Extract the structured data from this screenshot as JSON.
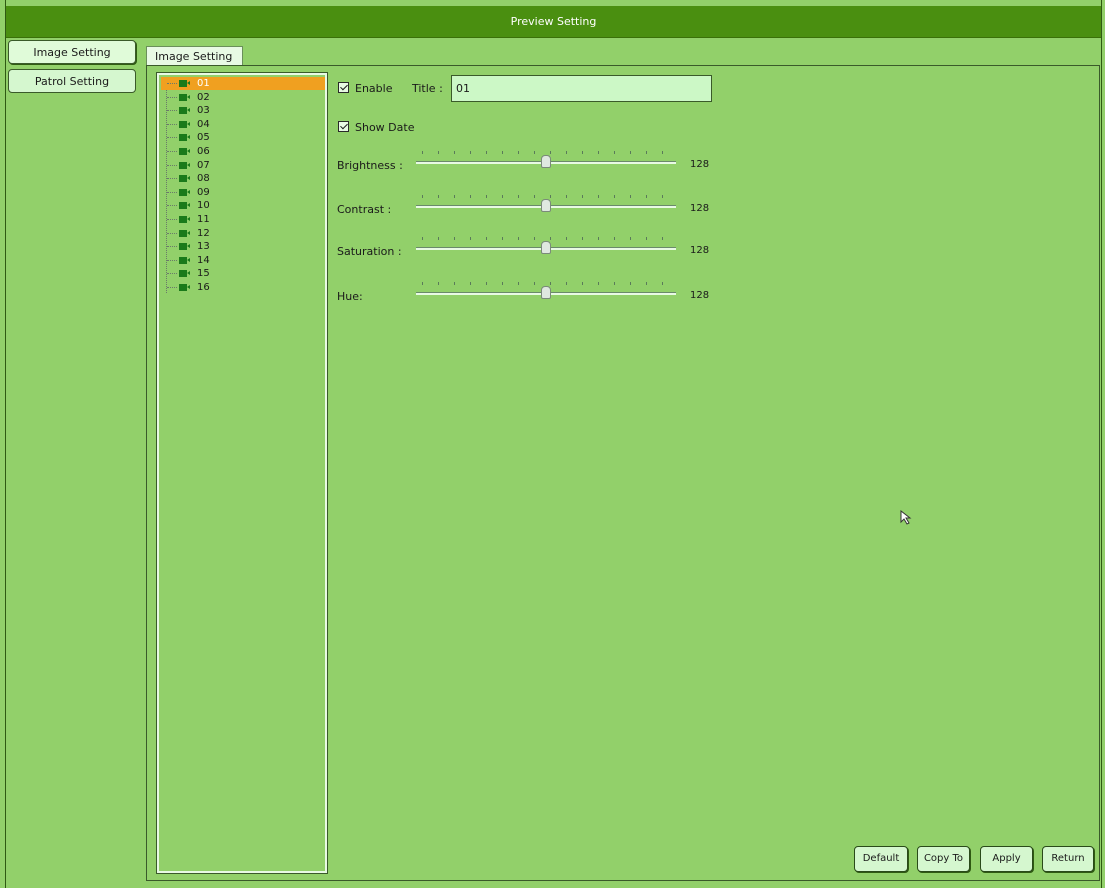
{
  "window": {
    "title": "Preview Setting"
  },
  "sidebar": {
    "items": [
      {
        "label": "Image Setting",
        "active": true
      },
      {
        "label": "Patrol Setting",
        "active": false
      }
    ]
  },
  "tab": {
    "label": "Image Setting"
  },
  "channels": {
    "selected": "01",
    "items": [
      "01",
      "02",
      "03",
      "04",
      "05",
      "06",
      "07",
      "08",
      "09",
      "10",
      "11",
      "12",
      "13",
      "14",
      "15",
      "16"
    ]
  },
  "settings": {
    "enable": {
      "label": "Enable",
      "checked": true
    },
    "title": {
      "label": "Title :",
      "value": "01"
    },
    "show_date": {
      "label": "Show Date",
      "checked": true
    },
    "sliders": [
      {
        "label": "Brightness :",
        "value": "128",
        "min": 0,
        "max": 255
      },
      {
        "label": "Contrast :",
        "value": "128",
        "min": 0,
        "max": 255
      },
      {
        "label": "Saturation :",
        "value": "128",
        "min": 0,
        "max": 255
      },
      {
        "label": "Hue:",
        "value": "128",
        "min": 0,
        "max": 255
      }
    ]
  },
  "buttons": {
    "default": "Default",
    "copy_to": "Copy To",
    "apply": "Apply",
    "return": "Return"
  },
  "colors": {
    "background": "#92d06a",
    "titlebar": "#4a8f10",
    "selected": "#f0a020",
    "camera_icon": "#1a7a1a"
  }
}
